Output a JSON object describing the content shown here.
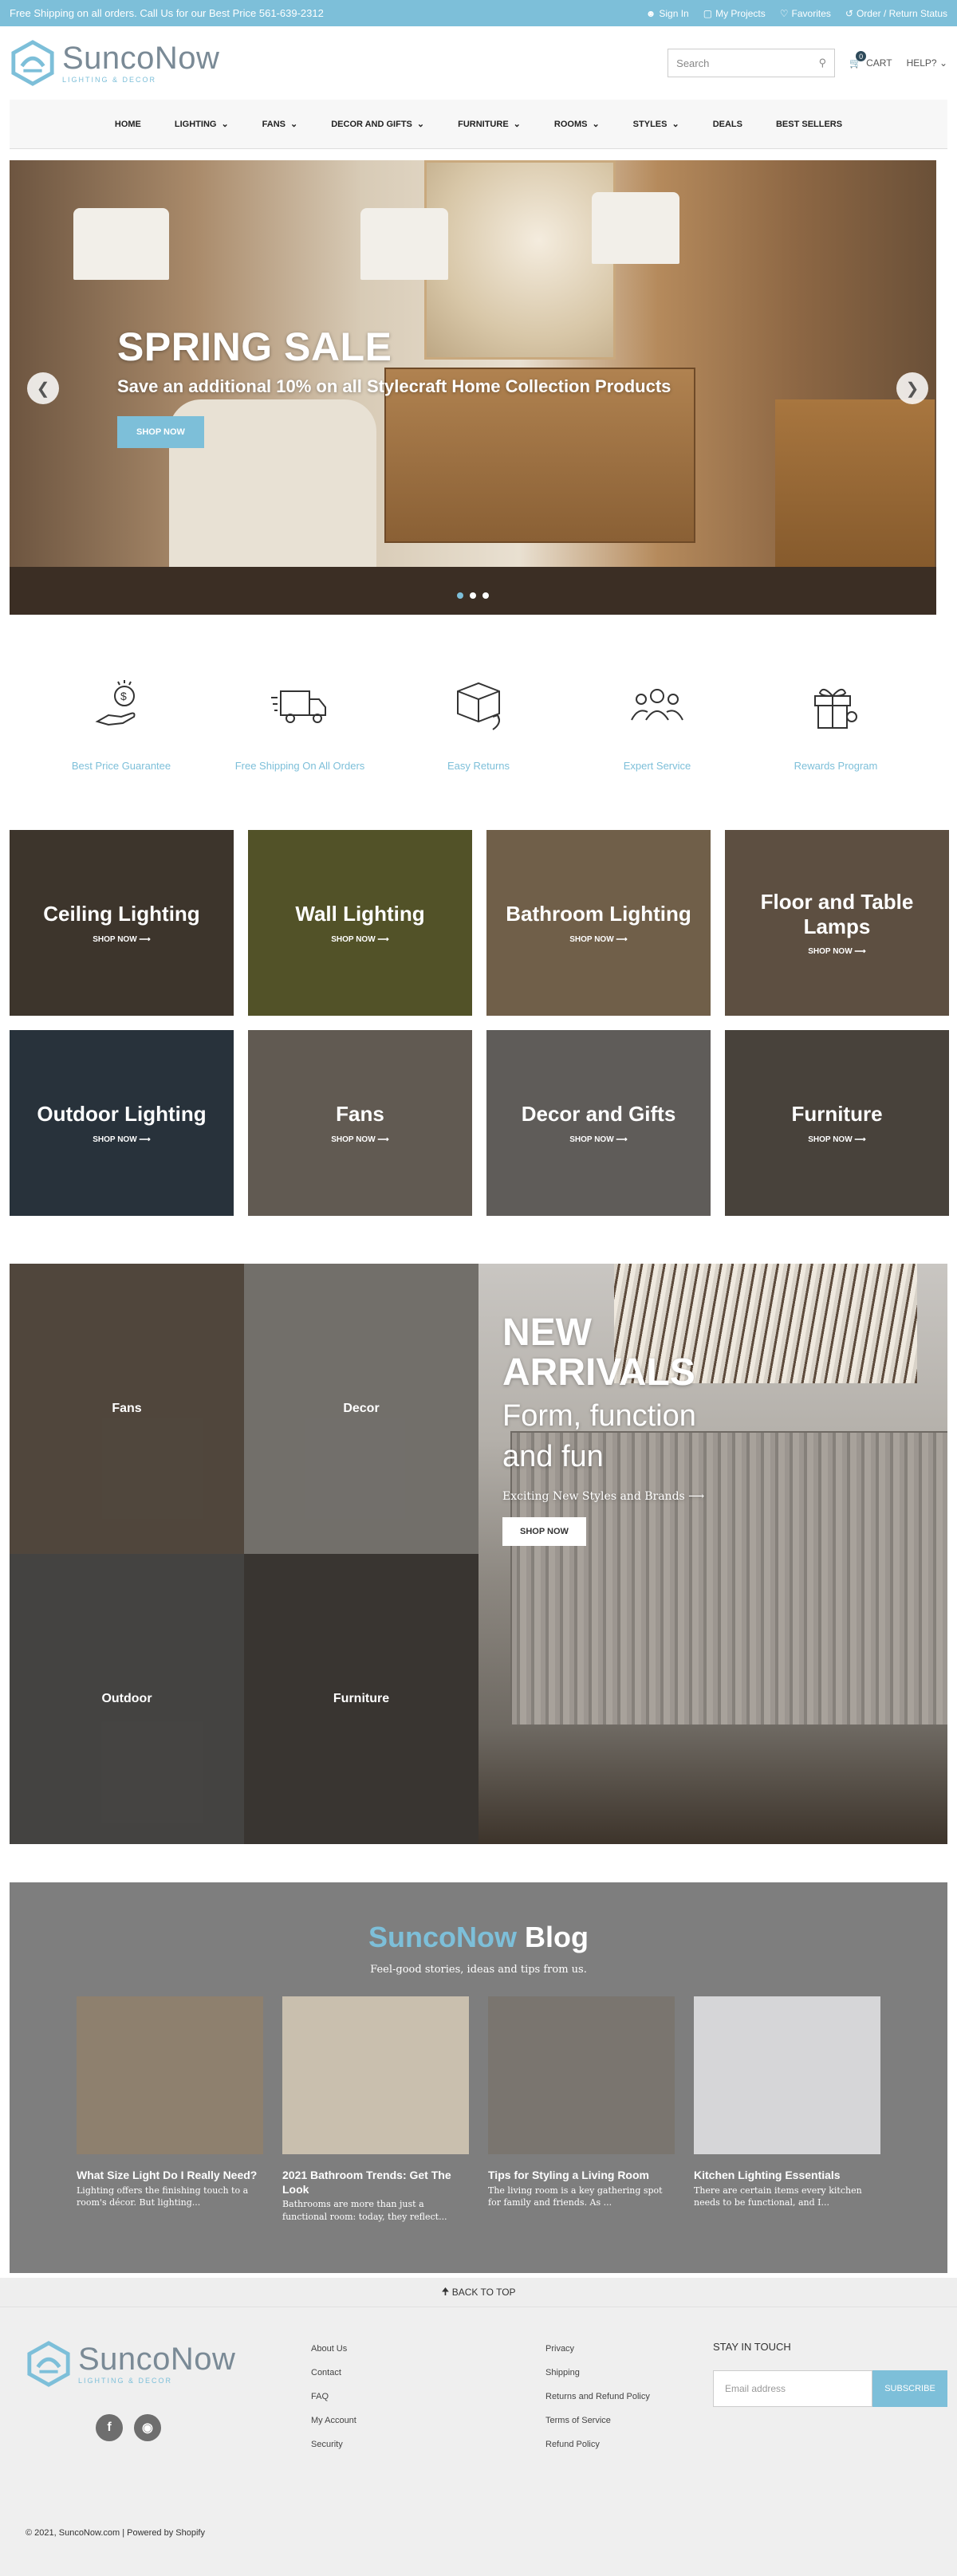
{
  "topbar": {
    "message": "Free Shipping on all orders. Call Us for our Best Price 561-639-2312",
    "links": [
      {
        "icon": "person-icon",
        "label": "Sign In"
      },
      {
        "icon": "folder-icon",
        "label": "My Projects"
      },
      {
        "icon": "heart-icon",
        "label": "Favorites"
      },
      {
        "icon": "return-icon",
        "label": "Order / Return Status"
      }
    ]
  },
  "header": {
    "brand": "SuncoNow",
    "tagline": "LIGHTING & DECOR",
    "search_placeholder": "Search",
    "cart_count": "0",
    "cart_label": "CART",
    "help_label": "HELP?"
  },
  "nav": {
    "items": [
      {
        "label": "HOME",
        "dropdown": false
      },
      {
        "label": "LIGHTING",
        "dropdown": true
      },
      {
        "label": "FANS",
        "dropdown": true
      },
      {
        "label": "DECOR AND GIFTS",
        "dropdown": true
      },
      {
        "label": "FURNITURE",
        "dropdown": true
      },
      {
        "label": "ROOMS",
        "dropdown": true
      },
      {
        "label": "STYLES",
        "dropdown": true
      },
      {
        "label": "DEALS",
        "dropdown": false
      },
      {
        "label": "BEST SELLERS",
        "dropdown": false
      }
    ]
  },
  "hero": {
    "title": "SPRING SALE",
    "subtitle": "Save an additional 10% on all Stylecraft Home Collection Products",
    "button": "SHOP NOW",
    "slides": 3,
    "active_slide": 1
  },
  "features": [
    {
      "icon": "dollar-hand-icon",
      "label": "Best Price Guarantee"
    },
    {
      "icon": "delivery-truck-icon",
      "label": "Free Shipping On All Orders"
    },
    {
      "icon": "box-return-icon",
      "label": "Easy Returns"
    },
    {
      "icon": "people-group-icon",
      "label": "Expert Service"
    },
    {
      "icon": "gift-icon",
      "label": "Rewards Program"
    }
  ],
  "categories": [
    {
      "title": "Ceiling Lighting",
      "shop": "SHOP NOW ⟶",
      "color": "#5b4e41"
    },
    {
      "title": "Wall Lighting",
      "shop": "SHOP NOW ⟶",
      "color": "#7a7a3c"
    },
    {
      "title": "Bathroom Lighting",
      "shop": "SHOP NOW ⟶",
      "color": "#a58c6c"
    },
    {
      "title": "Floor and Table Lamps",
      "shop": "SHOP NOW ⟶",
      "color": "#8a7560"
    },
    {
      "title": "Outdoor Lighting",
      "shop": "SHOP NOW ⟶",
      "color": "#3c4a58"
    },
    {
      "title": "Fans",
      "shop": "SHOP NOW ⟶",
      "color": "#8f8579"
    },
    {
      "title": "Decor and Gifts",
      "shop": "SHOP NOW ⟶",
      "color": "#8c8883"
    },
    {
      "title": "Furniture",
      "shop": "SHOP NOW ⟶",
      "color": "#6b6258"
    }
  ],
  "arrivals": {
    "tiles": [
      {
        "label": "Fans",
        "color": "#6f6254"
      },
      {
        "label": "Decor",
        "color": "#9e9a94"
      },
      {
        "label": "Outdoor",
        "color": "#5f5e5b"
      },
      {
        "label": "Furniture",
        "color": "#4f4a44"
      }
    ],
    "title_line1": "NEW",
    "title_line2": "ARRIVALS",
    "subtitle_line1": "Form, function",
    "subtitle_line2": "and fun",
    "link": "Exciting New Styles and Brands ⟶",
    "button": "SHOP NOW"
  },
  "blog": {
    "brand": "SuncoNow",
    "title": "Blog",
    "subtitle": "Feel-good stories, ideas and tips from us.",
    "posts": [
      {
        "title": "What Size Light Do I Really Need?",
        "excerpt": "Lighting offers the finishing touch to a room's décor. But lighting...",
        "color": "#8e806e"
      },
      {
        "title": "2021 Bathroom Trends: Get The Look",
        "excerpt": "Bathrooms are more than just a functional room: today, they reflect...",
        "color": "#c9bfae"
      },
      {
        "title": "Tips for Styling a Living Room",
        "excerpt": "The living room is a key gathering spot for family and friends. As ...",
        "color": "#7a756f"
      },
      {
        "title": "Kitchen Lighting Essentials",
        "excerpt": "There are certain items every kitchen needs to be functional, and I...",
        "color": "#d6d6d8"
      }
    ]
  },
  "back_to_top": "BACK TO TOP",
  "footer": {
    "col1": [
      "About Us",
      "Contact",
      "FAQ",
      "My Account",
      "Security"
    ],
    "col2": [
      "Privacy",
      "Shipping",
      "Returns and Refund Policy",
      "Terms of Service",
      "Refund Policy"
    ],
    "newsletter_label": "STAY IN TOUCH",
    "email_placeholder": "Email address",
    "subscribe": "SUBSCRIBE",
    "copyright": "© 2021, SuncoNow.com | Powered by Shopify"
  },
  "colors": {
    "accent": "#7dbfd9",
    "dark": "#2e4a5a",
    "blog_bg": "#7e7e7e"
  }
}
